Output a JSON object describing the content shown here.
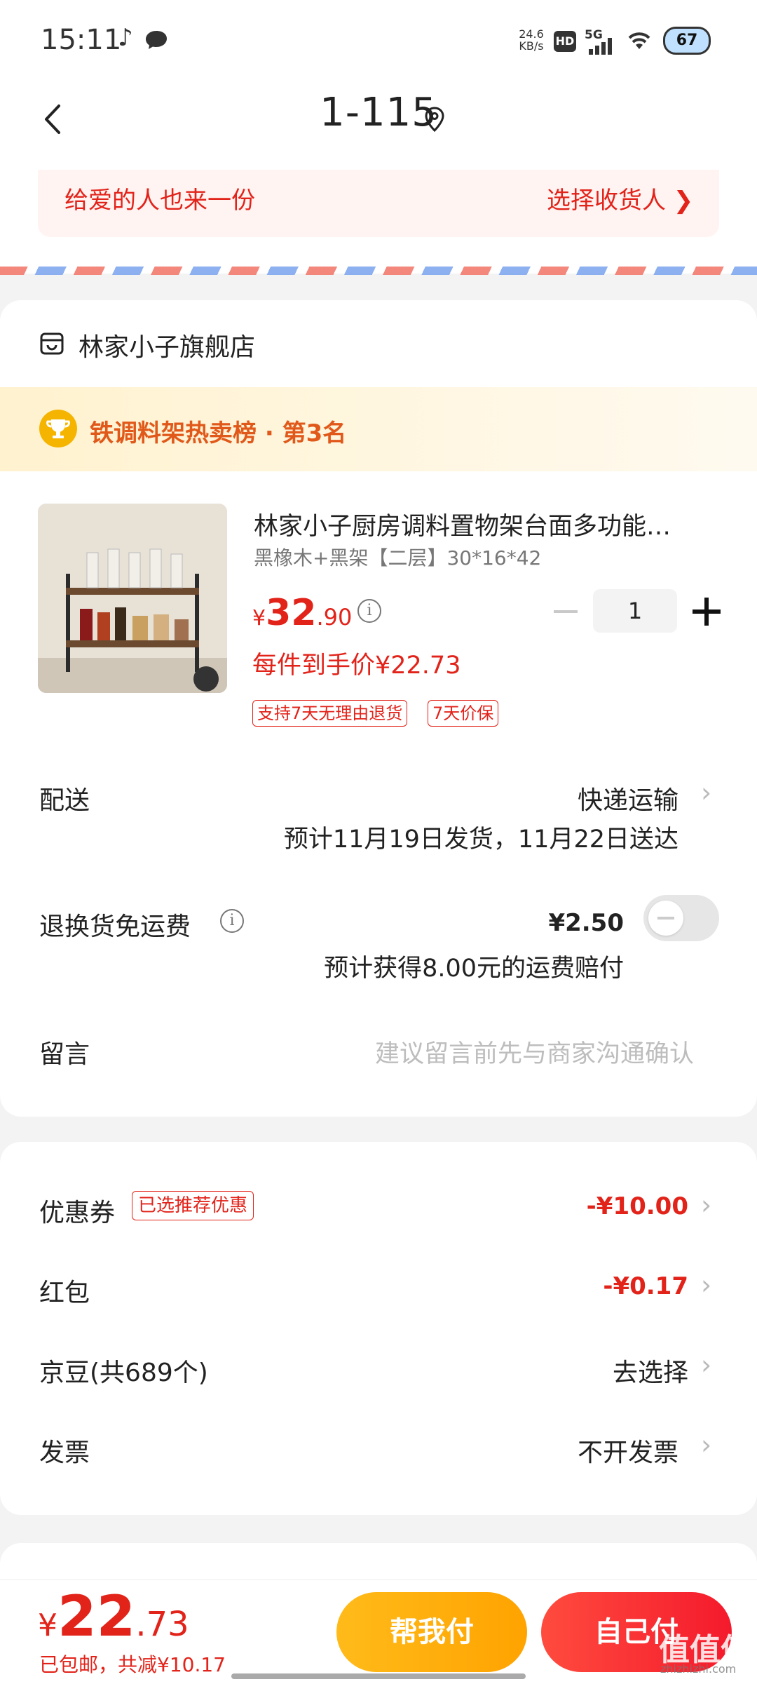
{
  "status_bar": {
    "time": "15:11",
    "music_icon": "♪",
    "net_speed_value": "24.6",
    "net_speed_unit": "KB/s",
    "hd_badge": "HD",
    "signal_label": "5G",
    "battery": "67"
  },
  "header": {
    "title": "1-115",
    "back_icon": "back-icon",
    "pin_icon": "location-pin-icon"
  },
  "address": {
    "gift_text": "给爱的人也来一份",
    "choose_receiver": "选择收货人 ❯"
  },
  "shop": {
    "name": "林家小子旗舰店",
    "rank_text": "铁调料架热卖榜 · 第3名",
    "product": {
      "title": "林家小子厨房调料置物架台面多功能…",
      "spec": "黑橡木+黑架【二层】30*16*42",
      "price_currency": "¥",
      "price_int": "32",
      "price_dec": ".90",
      "quantity": "1",
      "each_price": "每件到手价¥22.73",
      "tags": [
        "支持7天无理由退货",
        "7天价保"
      ]
    },
    "delivery": {
      "label": "配送",
      "value": "快递运输",
      "estimate": "预计11月19日发货，11月22日送达"
    },
    "return_shipping": {
      "label": "退换货免运费",
      "price": "¥2.50",
      "note": "预计获得8.00元的运费赔付",
      "enabled": false
    },
    "message": {
      "label": "留言",
      "placeholder": "建议留言前先与商家沟通确认"
    }
  },
  "discounts": {
    "coupon": {
      "label": "优惠券",
      "tag": "已选推荐优惠",
      "value": "-¥10.00"
    },
    "red_packet": {
      "label": "红包",
      "value": "-¥0.17"
    },
    "jd_beans": {
      "label": "京豆(共689个)",
      "value": "去选择"
    },
    "invoice": {
      "label": "发票",
      "value": "不开发票"
    },
    "chevron": "›"
  },
  "bottom": {
    "total_currency": "¥",
    "total_int": "22",
    "total_dec": ".73",
    "note": "已包邮，共减¥10.17",
    "help_pay": "帮我付",
    "self_pay": "自己付"
  },
  "watermark": {
    "text": "值值值",
    "sub": "zhizhizhi.com"
  },
  "colors": {
    "accent_red": "#e2231a",
    "help_button": "#ffa300",
    "rank_orange": "#e0591a"
  }
}
